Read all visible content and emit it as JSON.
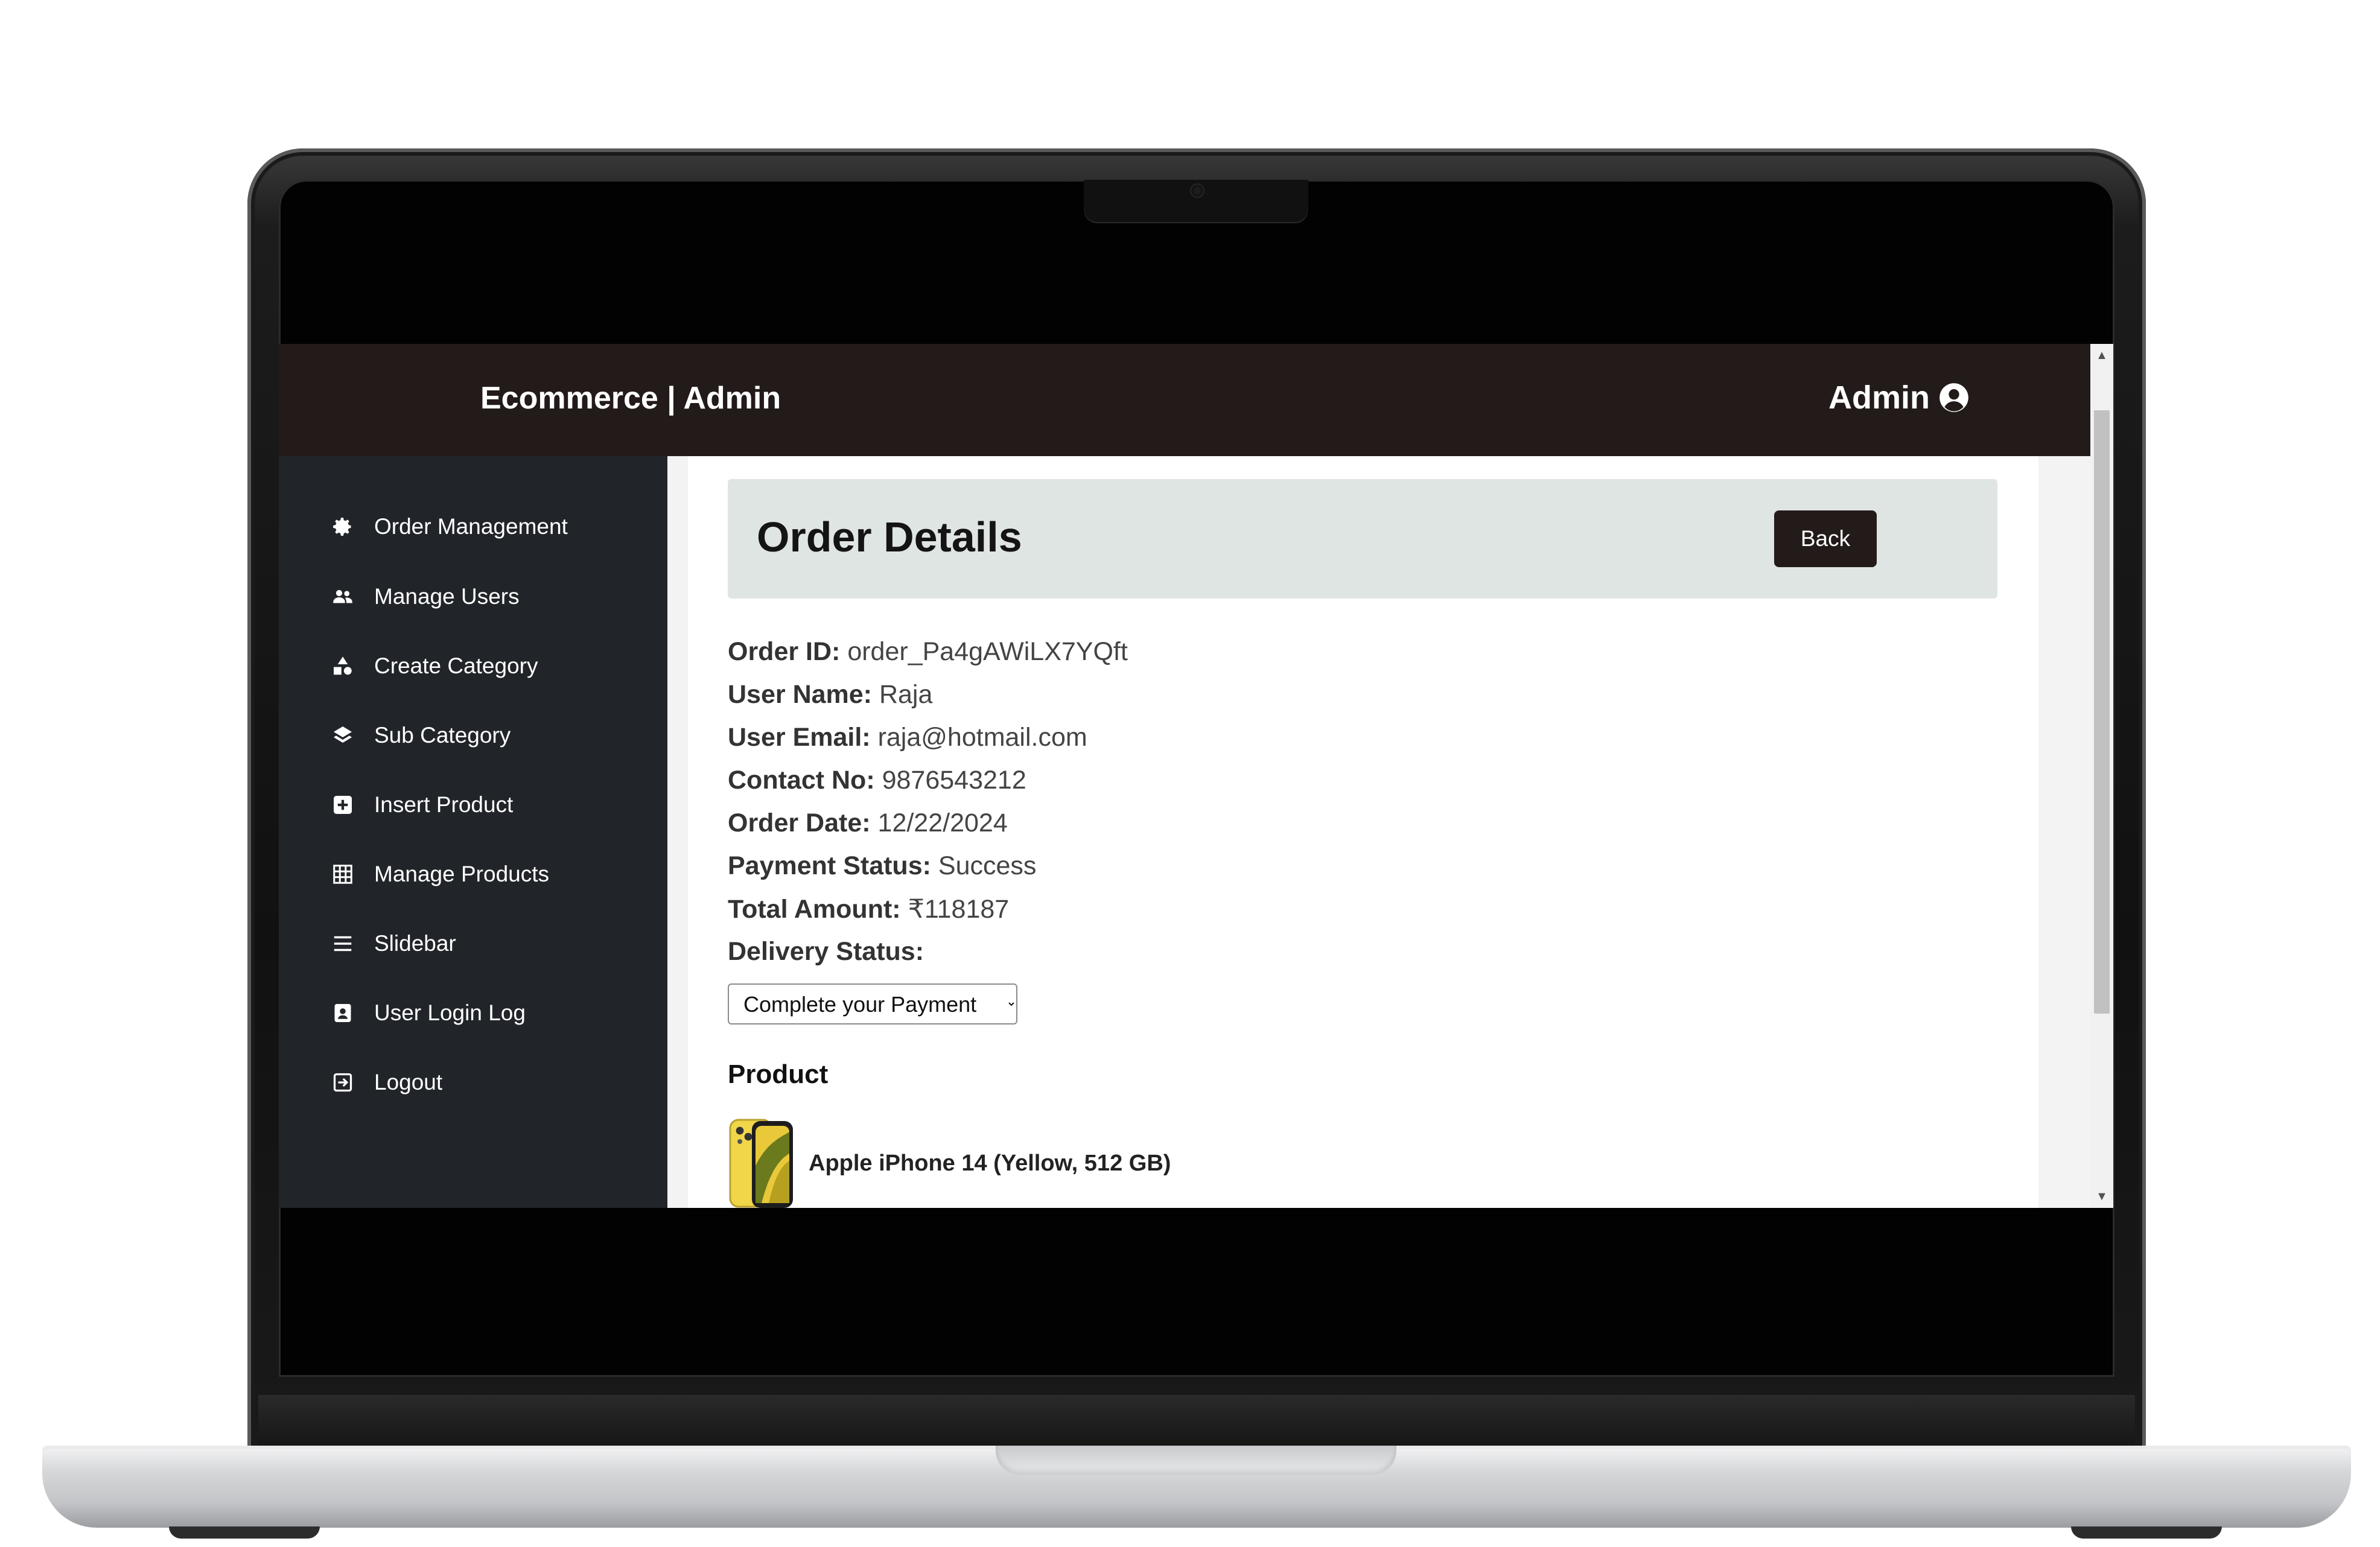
{
  "app": {
    "brand": "Ecommerce | Admin",
    "user_label": "Admin",
    "user_icon": "user-circle-icon"
  },
  "sidebar": {
    "items": [
      {
        "label": "Order Management",
        "icon": "gear-icon"
      },
      {
        "label": "Manage Users",
        "icon": "users-icon"
      },
      {
        "label": "Create Category",
        "icon": "shapes-icon"
      },
      {
        "label": "Sub Category",
        "icon": "layers-icon"
      },
      {
        "label": "Insert Product",
        "icon": "plus-square-icon"
      },
      {
        "label": "Manage Products",
        "icon": "grid-icon"
      },
      {
        "label": "Slidebar",
        "icon": "bars-icon"
      },
      {
        "label": "User Login Log",
        "icon": "id-badge-icon"
      },
      {
        "label": "Logout",
        "icon": "logout-icon"
      }
    ]
  },
  "page": {
    "title": "Order Details",
    "back_label": "Back"
  },
  "order": {
    "id_label": "Order ID:",
    "id": "order_Pa4gAWiLX7YQft",
    "user_name_label": "User Name:",
    "user_name": "Raja",
    "user_email_label": "User Email:",
    "user_email": "raja@hotmail.com",
    "contact_label": "Contact No:",
    "contact": "9876543212",
    "date_label": "Order Date:",
    "date": "12/22/2024",
    "payment_status_label": "Payment Status:",
    "payment_status": "Success",
    "total_label": "Total Amount:",
    "total": "₹118187",
    "delivery_status_label": "Delivery Status:",
    "delivery_status_selected": "Complete your Payment"
  },
  "product_section": {
    "title": "Product",
    "items": [
      {
        "name": "Apple iPhone 14 (Yellow, 512 GB)",
        "thumb": "iphone-yellow-image"
      }
    ]
  },
  "colors": {
    "topbar": "#231a1a",
    "sidebar": "#212529",
    "header_box": "#dfe5e3",
    "back_button": "#231a1a"
  }
}
